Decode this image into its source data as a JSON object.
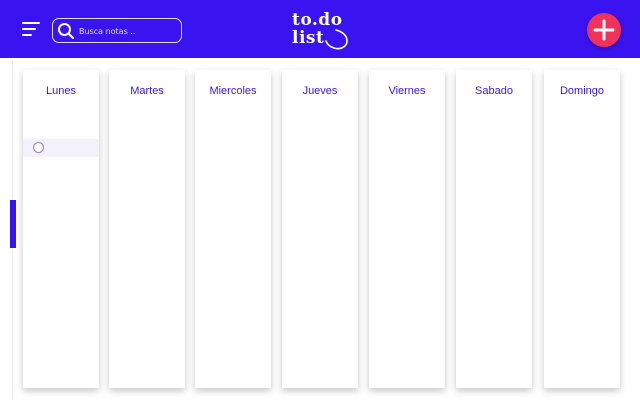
{
  "header": {
    "menu_icon": "hamburger-menu-icon",
    "search": {
      "placeholder": "Busca notas ..",
      "value": "",
      "icon": "search-icon"
    },
    "logo": {
      "line1": "to.do",
      "line2": "list"
    },
    "add_icon": "plus-icon"
  },
  "board": {
    "days": [
      "Lunes",
      "Martes",
      "Miercoles",
      "Jueves",
      "Viernes",
      "Sabado",
      "Domingo"
    ],
    "tasks": [
      {
        "day": "Lunes",
        "text": "",
        "done": false
      }
    ]
  },
  "colors": {
    "accent": "#3a14f0",
    "add_button": "#f0325a",
    "task_bg": "#f3f1fb"
  }
}
